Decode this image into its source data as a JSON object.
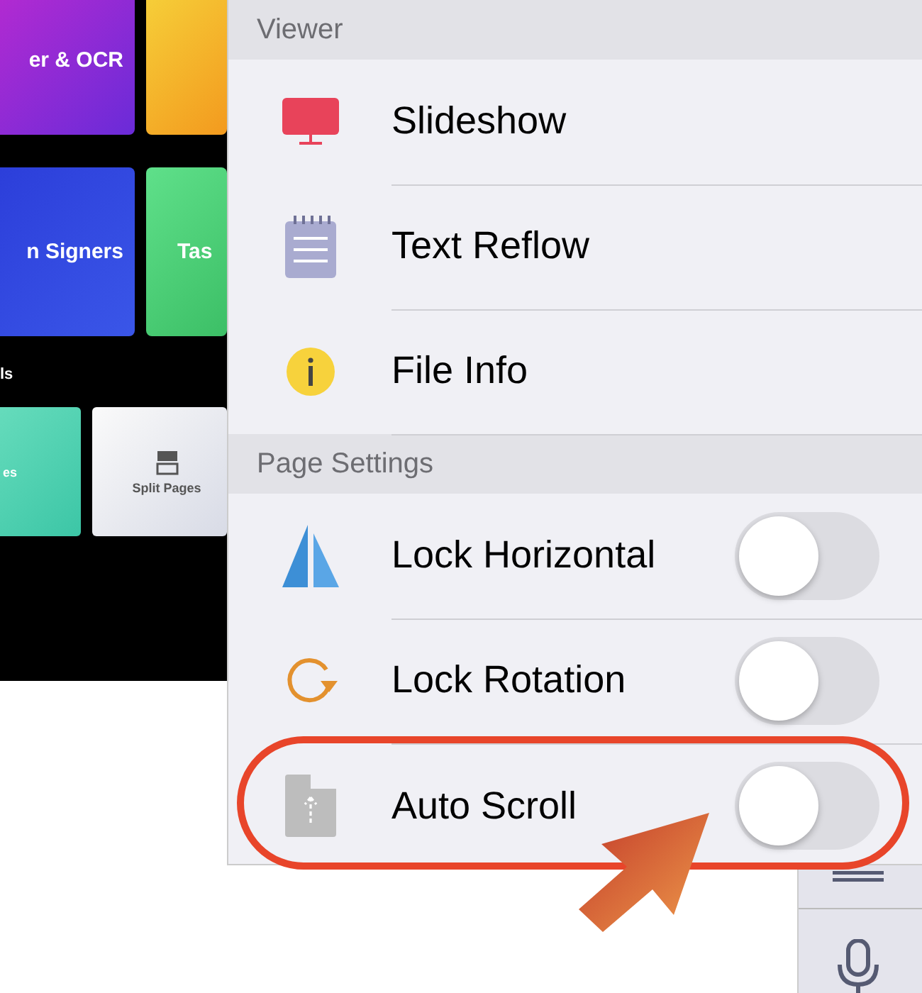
{
  "background_app": {
    "tiles": [
      {
        "label": "er & OCR"
      },
      {
        "label": "n Signers"
      },
      {
        "label": "Tas"
      }
    ],
    "section_label": "ls",
    "small_tiles": [
      {
        "label": "es"
      },
      {
        "label": "Split Pages"
      }
    ]
  },
  "menu": {
    "sections": [
      {
        "title": "Viewer",
        "rows": [
          {
            "label": "Slideshow",
            "kind": "link"
          },
          {
            "label": "Text Reflow",
            "kind": "link"
          },
          {
            "label": "File Info",
            "kind": "link"
          }
        ]
      },
      {
        "title": "Page Settings",
        "rows": [
          {
            "label": "Lock Horizontal",
            "kind": "toggle",
            "on": false
          },
          {
            "label": "Lock Rotation",
            "kind": "toggle",
            "on": false
          },
          {
            "label": "Auto Scroll",
            "kind": "toggle",
            "on": false
          }
        ]
      }
    ]
  }
}
